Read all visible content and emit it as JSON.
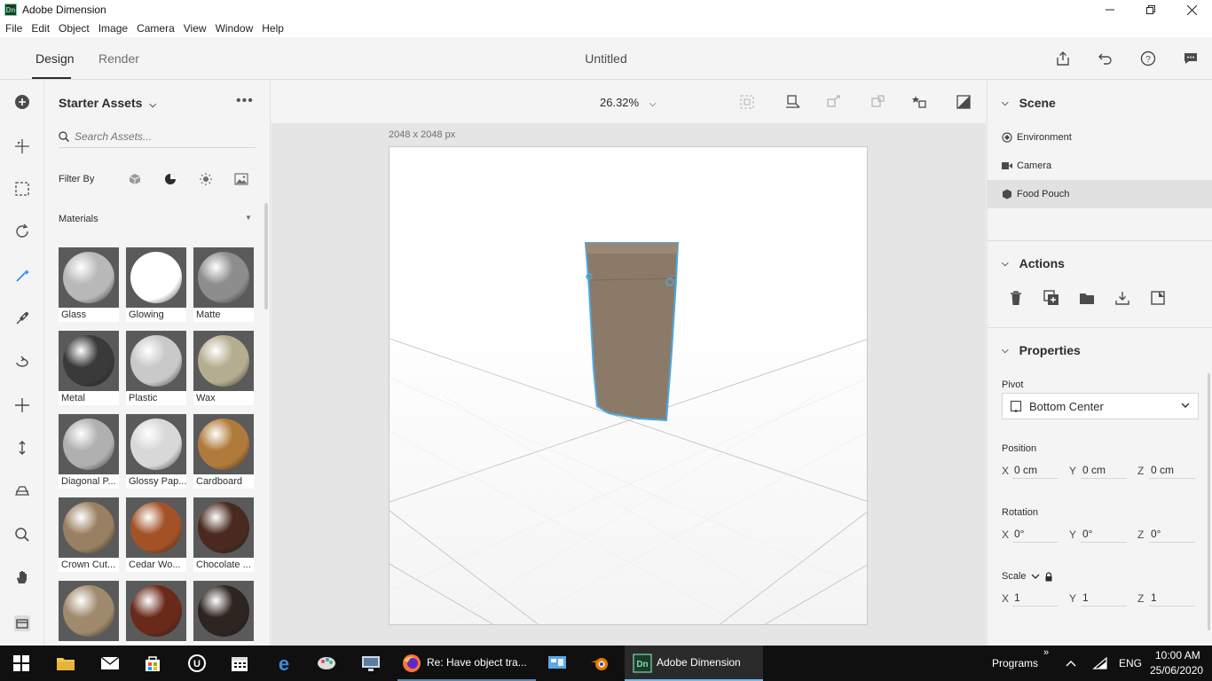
{
  "window": {
    "app_logo": "Dn",
    "title": "Adobe Dimension",
    "minimize_icon": "minimize-icon",
    "maximize_icon": "restore-icon",
    "close_icon": "close-icon"
  },
  "menu": [
    "File",
    "Edit",
    "Object",
    "Image",
    "Camera",
    "View",
    "Window",
    "Help"
  ],
  "header": {
    "tabs": [
      "Design",
      "Render"
    ],
    "document_title": "Untitled",
    "icons": [
      "share-icon",
      "undo-icon",
      "help-icon",
      "feedback-icon"
    ]
  },
  "toolbar": {
    "tools": [
      "add-icon",
      "select-icon",
      "frame-icon",
      "orbit-icon",
      "magic-wand-icon",
      "eyedropper-icon",
      "rotate-icon",
      "move-icon",
      "vertical-move-icon",
      "horizon-icon",
      "zoom-icon",
      "pan-icon",
      "panel-toggle-icon"
    ]
  },
  "assets": {
    "title": "Starter Assets",
    "search_placeholder": "Search Assets...",
    "filter_label": "Filter By",
    "section_label": "Materials",
    "materials": [
      {
        "label": "Glass",
        "color": "#b9b9b9"
      },
      {
        "label": "Glowing",
        "color": "#ffffff"
      },
      {
        "label": "Matte",
        "color": "#8d8d8d"
      },
      {
        "label": "Metal",
        "color": "#3a3a3a"
      },
      {
        "label": "Plastic",
        "color": "#c9c9c9"
      },
      {
        "label": "Wax",
        "color": "#b5ad8f"
      },
      {
        "label": "Diagonal P...",
        "color": "#b0b0b0"
      },
      {
        "label": "Glossy Pap...",
        "color": "#d8d8d8"
      },
      {
        "label": "Cardboard",
        "color": "#b07a3a"
      },
      {
        "label": "Crown Cut...",
        "color": "#9a8062"
      },
      {
        "label": "Cedar Wo...",
        "color": "#a35228"
      },
      {
        "label": "Chocolate ...",
        "color": "#4a2a20"
      },
      {
        "label": "",
        "color": "#a08a6e"
      },
      {
        "label": "",
        "color": "#6a2a1a"
      },
      {
        "label": "",
        "color": "#2e2420"
      }
    ]
  },
  "canvas": {
    "zoom": "26.32%",
    "dimensions": "2048 x 2048 px",
    "selection_color": "#4aa8e0"
  },
  "scene": {
    "title": "Scene",
    "items": [
      "Environment",
      "Camera",
      "Food Pouch"
    ],
    "selected": "Food Pouch"
  },
  "actions": {
    "title": "Actions",
    "icons": [
      "delete-icon",
      "duplicate-icon",
      "group-icon",
      "export-icon",
      "place-icon"
    ]
  },
  "properties": {
    "title": "Properties",
    "pivot_label": "Pivot",
    "pivot_value": "Bottom Center",
    "position_label": "Position",
    "position": {
      "x": "0 cm",
      "y": "0 cm",
      "z": "0 cm"
    },
    "rotation_label": "Rotation",
    "rotation": {
      "x": "0°",
      "y": "0°",
      "z": "0°"
    },
    "scale_label": "Scale",
    "scale": {
      "x": "1",
      "y": "1",
      "z": "1"
    },
    "axis_labels": [
      "X",
      "Y",
      "Z"
    ]
  },
  "taskbar": {
    "firefox_label": "Re: Have object tra...",
    "dimension_label": "Adobe Dimension",
    "programs_label": "Programs",
    "language": "ENG",
    "time": "10:00 AM",
    "date": "25/06/2020"
  }
}
